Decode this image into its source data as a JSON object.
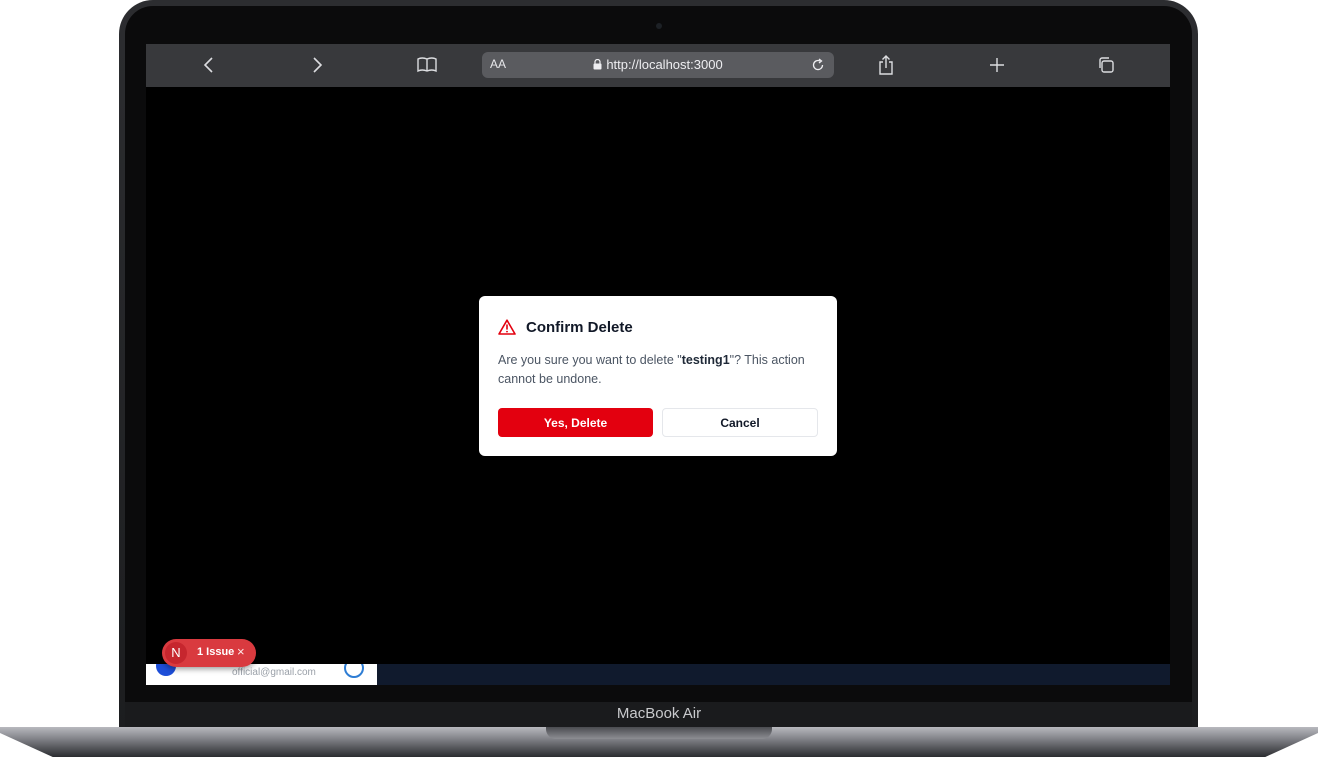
{
  "device": {
    "label": "MacBook Air"
  },
  "browser": {
    "reader_label": "AA",
    "url": "http://localhost:3000",
    "icons": [
      "chevron-left-icon",
      "chevron-right-icon",
      "book-icon",
      "lock-icon",
      "reload-icon",
      "share-icon",
      "plus-icon",
      "tabs-icon"
    ]
  },
  "modal": {
    "title": "Confirm Delete",
    "body_prefix": "Are you sure you want to delete \"",
    "item_name": "testing1",
    "body_suffix": "\"? This action cannot be undone.",
    "confirm_label": "Yes, Delete",
    "cancel_label": "Cancel",
    "accent_color": "#e3000f"
  },
  "dev_badge": {
    "logo_letter": "N",
    "label": "1 Issue",
    "close_glyph": "×"
  },
  "page": {
    "user_email": "official@gmail.com"
  }
}
